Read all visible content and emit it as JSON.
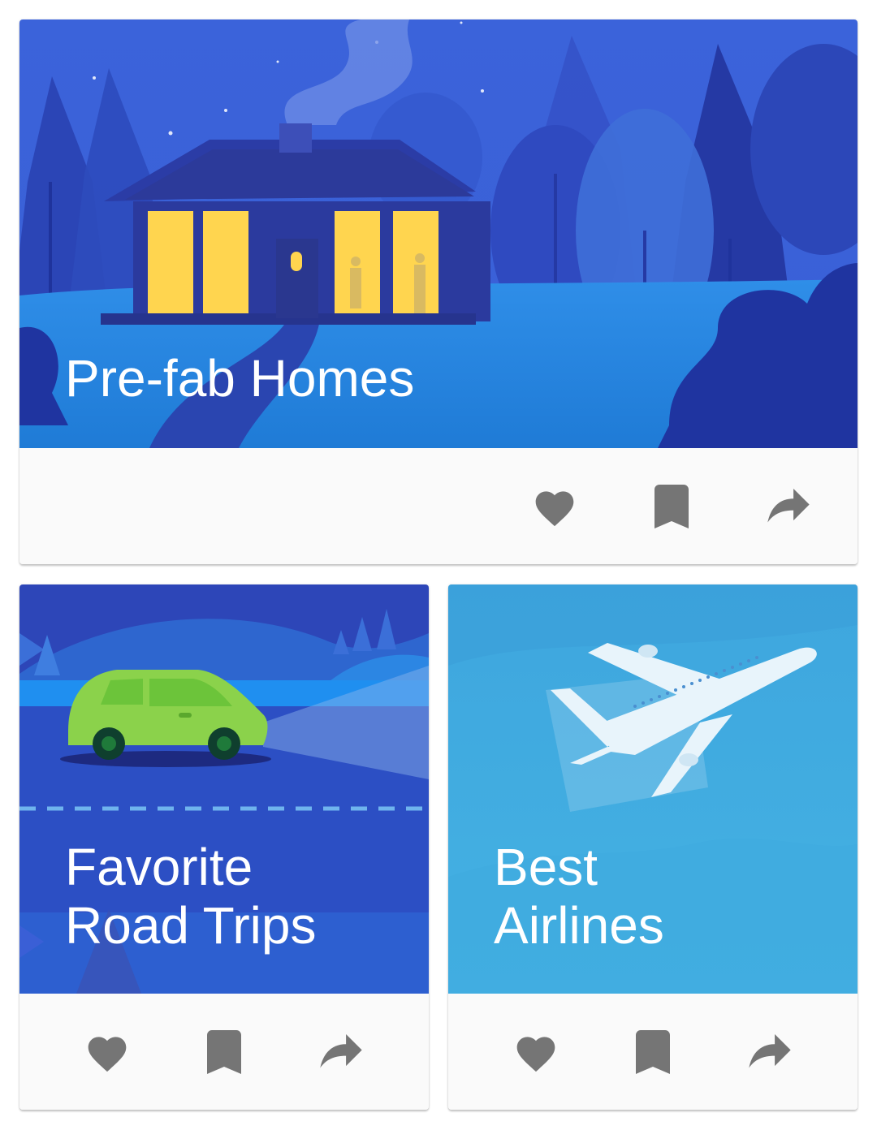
{
  "colors": {
    "card_background": "#fafafa",
    "action_icon": "#757575",
    "title_text": "#ffffff",
    "night_sky": "#3a5fd6",
    "night_tree_dark": "#2a3fa8",
    "window_light": "#ffd54f",
    "road_blue": "#2d55c8",
    "car_green": "#8bd24b",
    "sky_light": "#45aee0",
    "plane": "#e8f4fb"
  },
  "cards": [
    {
      "id": "prefab",
      "title_lines": [
        "Pre-fab Homes"
      ],
      "illustration": "night-house-illustration",
      "actions": [
        {
          "icon": "heart-icon",
          "label": "favorite"
        },
        {
          "icon": "bookmark-icon",
          "label": "bookmark"
        },
        {
          "icon": "share-icon",
          "label": "share"
        }
      ]
    },
    {
      "id": "road",
      "title_lines": [
        "Favorite",
        "Road Trips"
      ],
      "illustration": "car-road-illustration",
      "actions": [
        {
          "icon": "heart-icon",
          "label": "favorite"
        },
        {
          "icon": "bookmark-icon",
          "label": "bookmark"
        },
        {
          "icon": "share-icon",
          "label": "share"
        }
      ]
    },
    {
      "id": "air",
      "title_lines": [
        "Best",
        "Airlines"
      ],
      "illustration": "airplane-illustration",
      "actions": [
        {
          "icon": "heart-icon",
          "label": "favorite"
        },
        {
          "icon": "bookmark-icon",
          "label": "bookmark"
        },
        {
          "icon": "share-icon",
          "label": "share"
        }
      ]
    }
  ]
}
